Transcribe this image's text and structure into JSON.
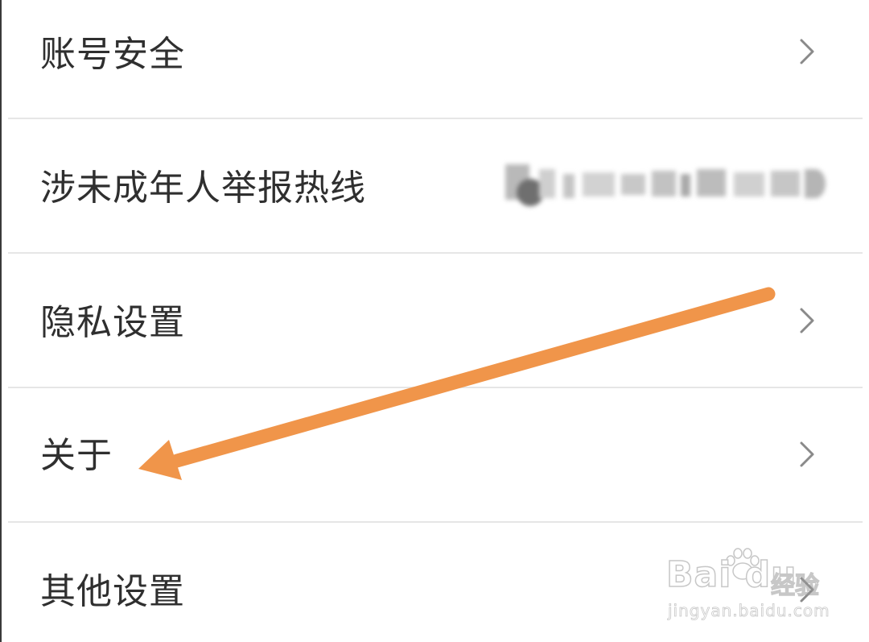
{
  "settings": {
    "items": [
      {
        "label": "账号安全",
        "has_chevron": true,
        "icon": "chevron-right-icon"
      },
      {
        "label": "涉未成年人举报热线",
        "has_chevron": false,
        "value": "[blurred phone number]"
      },
      {
        "label": "隐私设置",
        "has_chevron": true,
        "icon": "chevron-right-icon"
      },
      {
        "label": "关于",
        "has_chevron": true,
        "icon": "chevron-right-icon"
      },
      {
        "label": "其他设置",
        "has_chevron": true,
        "icon": "chevron-right-icon"
      }
    ]
  },
  "annotation": {
    "icon": "arrow-annotation",
    "color": "#F0954A",
    "points_to": "关于"
  },
  "watermark": {
    "brand": "Bai du",
    "brand_cn": "经验",
    "url": "jingyan.baidu.com",
    "icon": "paw-icon"
  },
  "colors": {
    "text": "#2f2f2f",
    "divider": "#e6e6e6",
    "chevron": "#8a8a8a",
    "background": "#ffffff"
  }
}
